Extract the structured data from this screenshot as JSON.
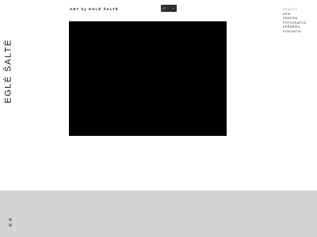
{
  "sidebar": {
    "title": "EGLĖ ŠALTĖ"
  },
  "header": {
    "brand": "ART by EGLĖ ŠALTĖ",
    "language": {
      "selected": "LT",
      "chevron": "chevron-down-icon"
    }
  },
  "menu": {
    "items": [
      {
        "label": "PRADŽIA",
        "active": true
      },
      {
        "label": "APIE",
        "active": false
      },
      {
        "label": "GRAFIKA",
        "active": false
      },
      {
        "label": "FOTOGRAFIJA",
        "active": false
      },
      {
        "label": "KERAMIKA",
        "active": false
      },
      {
        "label": "KONTAKTAI",
        "active": false
      }
    ]
  },
  "hero": {
    "image": "black-artwork-image"
  },
  "footer": {
    "icons": [
      "facebook-icon",
      "instagram-icon"
    ]
  },
  "colors": {
    "hero": "#000000",
    "footer": "#d4d4d4",
    "menu_active": "#9a9a9a",
    "language_bg": "#2e2e2e"
  }
}
